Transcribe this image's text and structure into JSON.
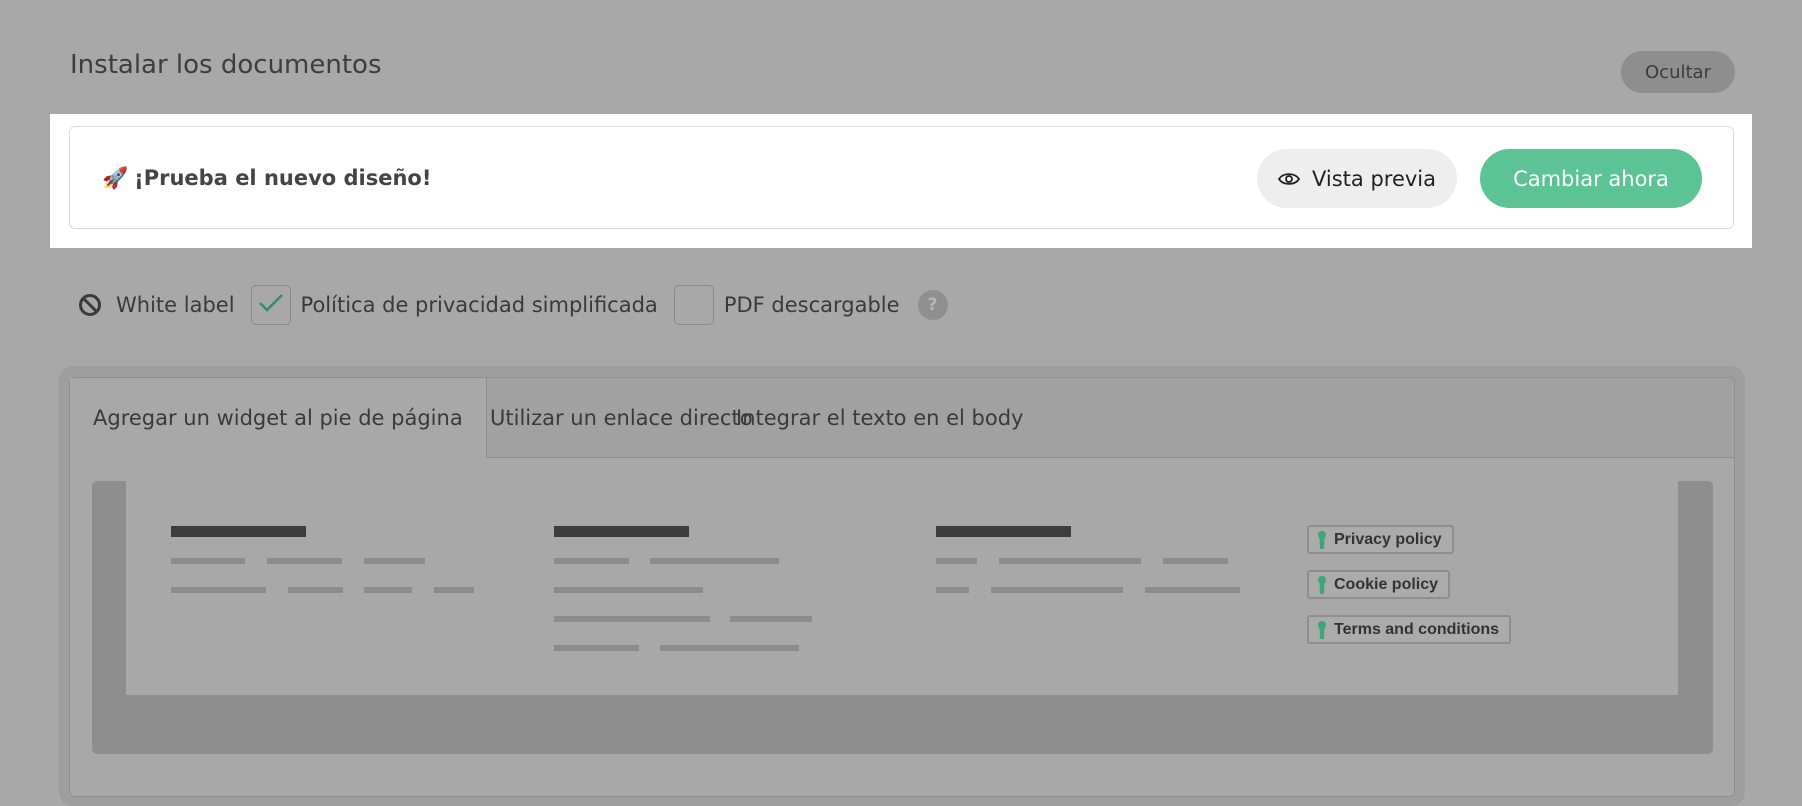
{
  "header": {
    "title": "Instalar los documentos",
    "hide_label": "Ocultar"
  },
  "banner": {
    "icon": "rocket-icon",
    "icon_glyph": "🚀",
    "text": "¡Prueba el nuevo diseño!",
    "preview_label": "Vista previa",
    "change_label": "Cambiar ahora",
    "accent_color": "#5cc396"
  },
  "options": {
    "white_label": {
      "label": "White label",
      "enabled": false
    },
    "simplified_policy": {
      "label": "Política de privacidad simplificada",
      "checked": true
    },
    "pdf": {
      "label": "PDF descargable",
      "checked": false
    },
    "help_glyph": "?"
  },
  "tabs": [
    {
      "label": "Agregar un widget al pie de página",
      "active": true
    },
    {
      "label": "Utilizar un enlace directo",
      "active": false
    },
    {
      "label": "Integrar el texto en el body",
      "active": false
    }
  ],
  "footer_preview": {
    "links": [
      {
        "label": "Privacy policy"
      },
      {
        "label": "Cookie policy"
      },
      {
        "label": "Terms and conditions"
      }
    ]
  }
}
